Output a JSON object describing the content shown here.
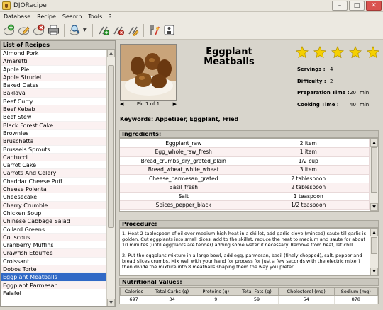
{
  "window": {
    "title": "DJORecipe"
  },
  "menu": [
    "Database",
    "Recipe",
    "Search",
    "Tools",
    "?"
  ],
  "toolbar": {
    "buttons": [
      "new-recipe-icon",
      "edit-recipe-icon",
      "delete-recipe-icon",
      "print-icon",
      "search-icon",
      "tools-icon",
      "delete-tool-icon",
      "edit-tool-icon",
      "kitchen-icon",
      "help-icon"
    ]
  },
  "list": {
    "header": "List of Recipes",
    "items": [
      "Almond Pork",
      "Amaretti",
      "Apple Pie",
      "Apple Strudel",
      "Baked Dates",
      "Baklava",
      "Beef Curry",
      "Beef Kebab",
      "Beef Stew",
      "Black Forest Cake",
      "Brownies",
      "Bruschetta",
      "Brussels Sprouts",
      "Cantucci",
      "Carrot Cake",
      "Carrots And Celery",
      "Cheddar Cheese Puff",
      "Cheese Polenta",
      "Cheesecake",
      "Cherry Crumble",
      "Chicken Soup",
      "Chinese Cabbage Salad",
      "Collard Greens",
      "Couscous",
      "Cranberry Muffins",
      "Crawfish Etouffee",
      "Croissant",
      "Dobos Torte",
      "Eggplant Meatballs",
      "Eggplant Parmesan",
      "Falafel"
    ],
    "selected": "Eggplant Meatballs"
  },
  "recipe": {
    "title": "Eggplant Meatballs",
    "pic_caption": "Pic 1 of 1",
    "rating": 5,
    "servings_label": "Servings :",
    "servings": "4",
    "difficulty_label": "Difficulty :",
    "difficulty": "2",
    "prep_label": "Preparation Time :",
    "prep": "20",
    "prep_unit": "min",
    "cook_label": "Cooking Time :",
    "cook": "40",
    "cook_unit": "min",
    "keywords_label": "Keywords:",
    "keywords": "Appetizer, Eggplant, Fried"
  },
  "ingredients": {
    "header": "Ingredients:",
    "rows": [
      [
        "Eggplant_raw",
        "2 item"
      ],
      [
        "Egg_whole_raw_fresh",
        "1 item"
      ],
      [
        "Bread_crumbs_dry_grated_plain",
        "1/2 cup"
      ],
      [
        "Bread_wheat_white_wheat",
        "3 item"
      ],
      [
        "Cheese_parmesan_grated",
        "2 tablespoon"
      ],
      [
        "Basil_fresh",
        "2 tablespoon"
      ],
      [
        "Salt",
        "1 teaspoon"
      ],
      [
        "Spices_pepper_black",
        "1/2 teaspoon"
      ]
    ]
  },
  "procedure": {
    "header": "Procedure:",
    "paragraphs": [
      "1. Heat 2 tablespoon of oil over medium-high heat in a skillet, add garlic clove (minced) saute till garlic is golden. Cut eggplants into small dices, add to the skillet, reduce the  heat to medium and saute for about 10 minutes (until eggplants are tender) adding some water if necessary. Remove from heat, let chill.",
      "2. Put the eggplant mixture in a large bowl, add egg, parmesan, basil (finely chopped), salt, pepper and bread slices crumbs. Mix well with your hand (or process for just a few seconds with the  electric mixer) then divide the mixture into 8 meatballs shaping them the way you prefer."
    ]
  },
  "nutrition": {
    "header": "Nutritional Values:",
    "columns": [
      "Calories",
      "Total Carbs (g)",
      "Proteins (g)",
      "Total Fats (g)",
      "Cholesterol (mg)",
      "Sodium (mg)"
    ],
    "values": [
      "697",
      "34",
      "9",
      "59",
      "54",
      "878"
    ]
  },
  "colors": {
    "selection": "#3169c6",
    "star": "#f5d000",
    "panel_header": "#c9c6bd"
  }
}
